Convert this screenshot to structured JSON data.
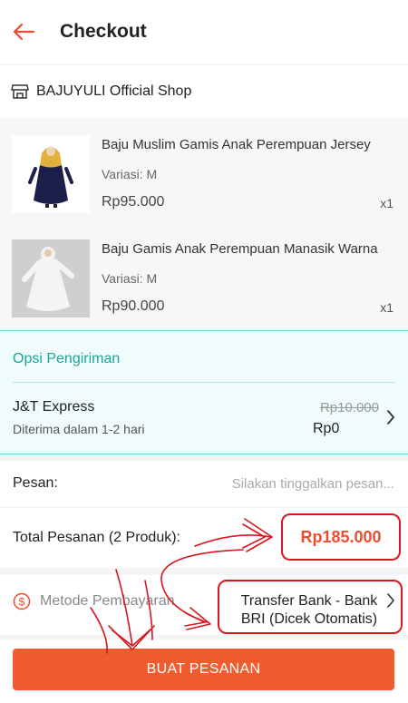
{
  "header": {
    "title": "Checkout",
    "back_icon": "arrow-left-icon",
    "accent": "#ee4d2d"
  },
  "shop": {
    "name": "BAJUYULI Official Shop",
    "icon": "store-icon"
  },
  "products": [
    {
      "name": "Baju Muslim Gamis Anak Perempuan Jersey",
      "variant": "Variasi: M",
      "price": "Rp95.000",
      "qty": "x1"
    },
    {
      "name": "Baju Gamis Anak Perempuan Manasik Warna",
      "variant": "Variasi: M",
      "price": "Rp90.000",
      "qty": "x1"
    }
  ],
  "shipping": {
    "title": "Opsi Pengiriman",
    "courier": "J&T Express",
    "eta": "Diterima dalam 1-2 hari",
    "old_cost": "Rp10.000",
    "cost": "Rp0",
    "accent": "#1aa698"
  },
  "message": {
    "label": "Pesan:",
    "placeholder": "Silakan tinggalkan pesan..."
  },
  "total": {
    "label": "Total Pesanan (2 Produk):",
    "value": "Rp185.000"
  },
  "payment": {
    "label": "Metode Pembayaran",
    "icon": "dollar-circle-icon",
    "value": "Transfer Bank - Bank BRI (Dicek Otomatis)"
  },
  "footer": {
    "button_label": "BUAT PESANAN"
  },
  "annotation_color": "#d9161d"
}
